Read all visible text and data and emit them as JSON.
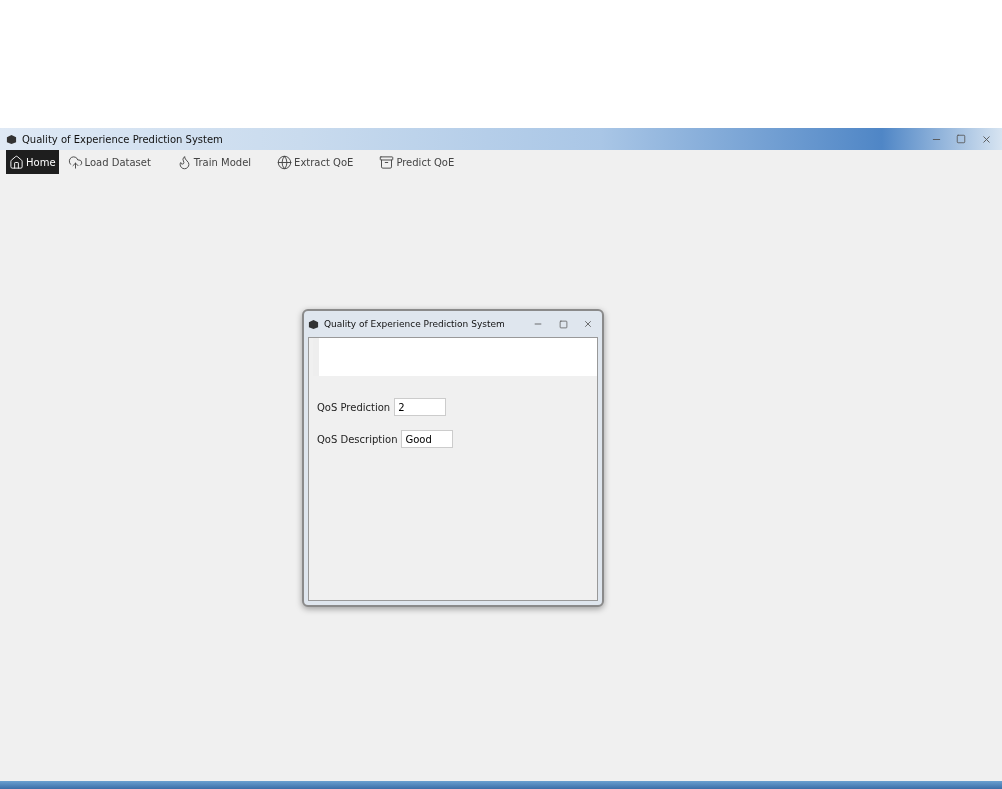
{
  "window": {
    "title": "Quality of Experience Prediction System"
  },
  "toolbar": [
    {
      "label": "Home",
      "selected": true
    },
    {
      "label": "Load Dataset",
      "selected": false
    },
    {
      "label": "Train Model",
      "selected": false
    },
    {
      "label": "Extract QoE",
      "selected": false
    },
    {
      "label": "Predict QoE",
      "selected": false
    }
  ],
  "dialog": {
    "title": "Quality of Experience Prediction System",
    "fields": [
      {
        "label": "QoS Prediction",
        "value": "2"
      },
      {
        "label": "QoS Description",
        "value": "Good"
      }
    ]
  }
}
